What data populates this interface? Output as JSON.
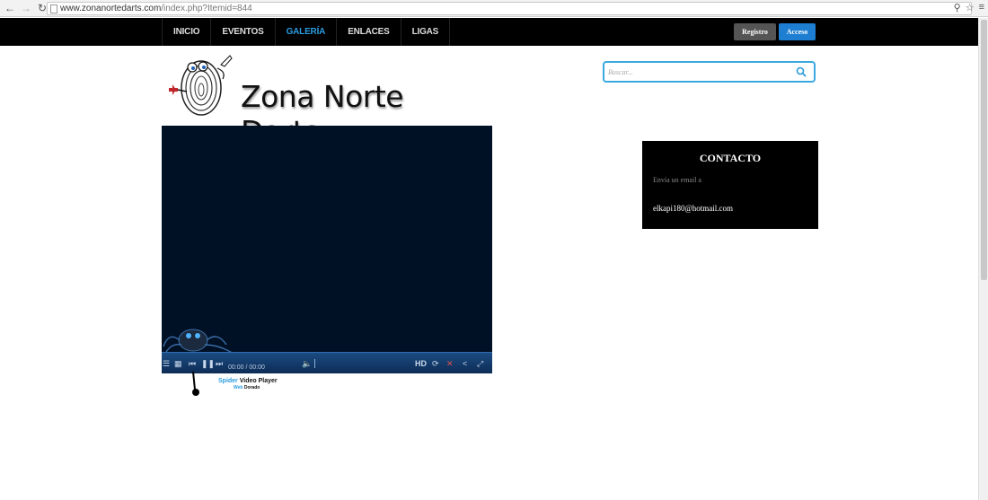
{
  "browser": {
    "url_domain": "www.zonanortedarts.com",
    "url_path": "/index.php?Itemid=844"
  },
  "nav": {
    "items": [
      {
        "label": "INICIO"
      },
      {
        "label": "EVENTOS"
      },
      {
        "label": "GALERÍA",
        "active": true
      },
      {
        "label": "ENLACES"
      },
      {
        "label": "LIGAS"
      }
    ],
    "registro_label": "Registro",
    "acceso_label": "Acceso"
  },
  "logo": {
    "text": "Zona Norte Darts"
  },
  "search": {
    "placeholder": "Buscar..."
  },
  "video": {
    "timecode": "00:00 / 00:00",
    "hd_label": "HD",
    "caption_brand": "Spider",
    "caption_rest": " Video Player",
    "caption_sub_blue": "Web",
    "caption_sub_rest": " Dorado"
  },
  "contacto": {
    "title": "CONTACTO",
    "subtitle": "Envía un email a",
    "email": "elkapi180@hotmail.com"
  },
  "colors": {
    "accent": "#2b9be0",
    "nav_bg": "#000000",
    "video_bg": "#001025"
  }
}
